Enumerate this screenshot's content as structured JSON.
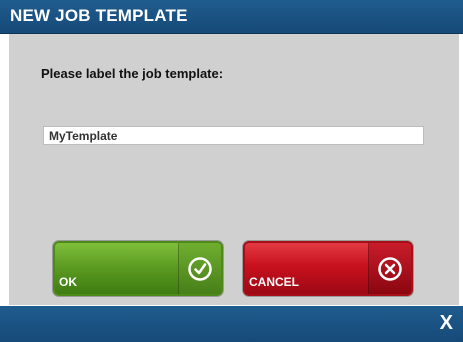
{
  "dialog": {
    "title": "NEW JOB TEMPLATE",
    "prompt": "Please label the job template:",
    "input_value": "MyTemplate"
  },
  "buttons": {
    "ok_label": "OK",
    "ok_icon": "check-circle-icon",
    "cancel_label": "CANCEL",
    "cancel_icon": "x-circle-icon"
  },
  "footer": {
    "close_label": "X"
  },
  "colors": {
    "title_bar": "#1f5c8e",
    "panel": "#d0d0d0",
    "ok_green": "#5d9c22",
    "cancel_red": "#c8101e"
  }
}
